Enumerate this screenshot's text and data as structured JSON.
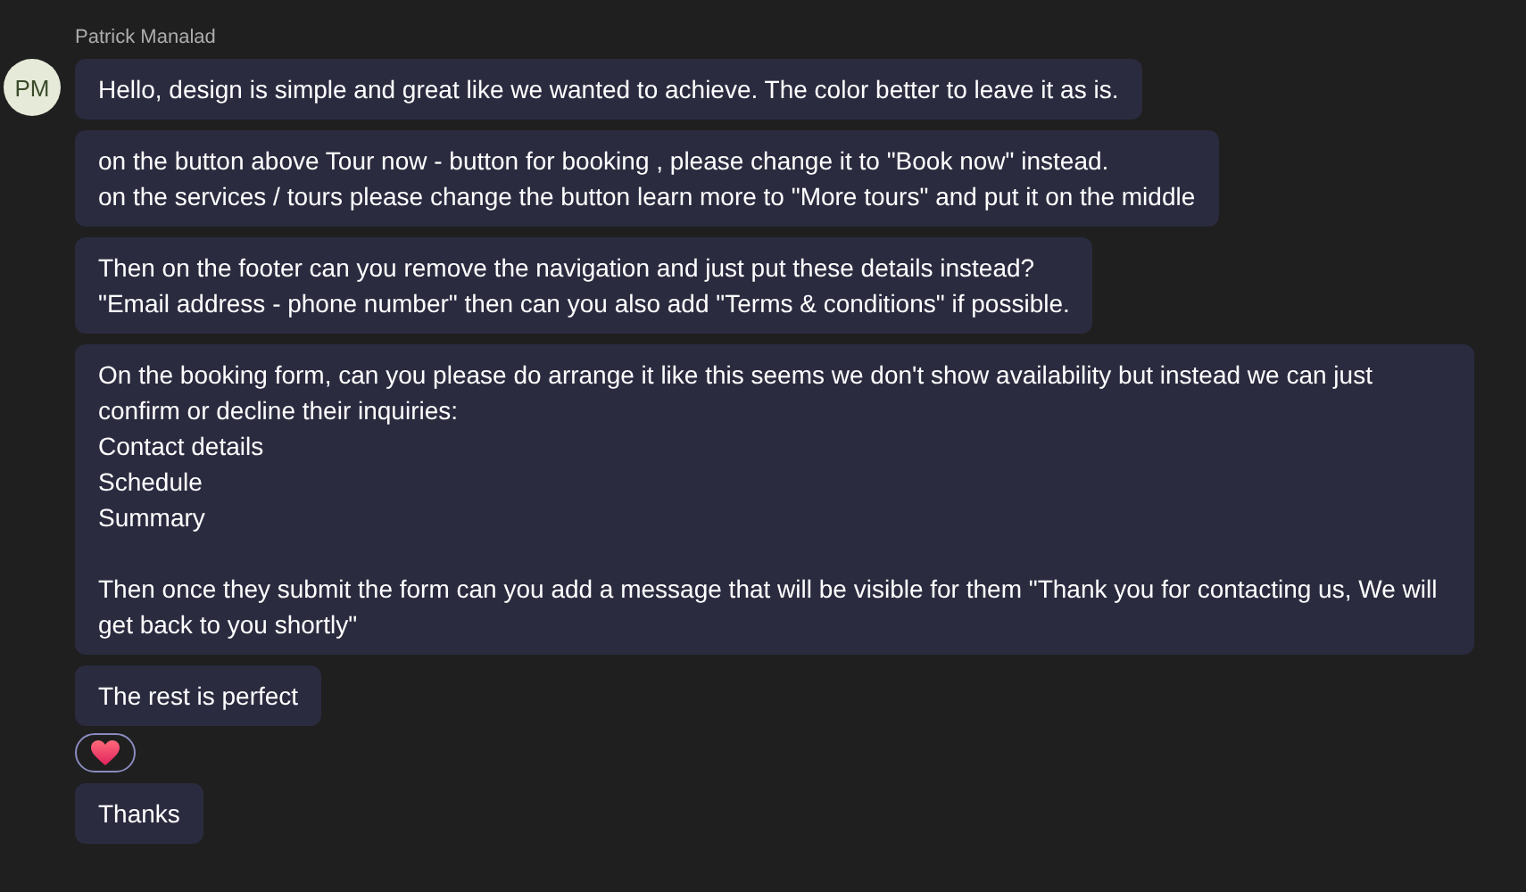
{
  "sender": {
    "name": "Patrick Manalad",
    "initials": "PM"
  },
  "messages": [
    {
      "text": "Hello, design is simple and great like we wanted to achieve. The color better to leave it as is."
    },
    {
      "text": "on the button above Tour now - button for booking , please change it to \"Book now\" instead.\non the services / tours please change the button learn more to \"More tours\" and put it on the middle\n "
    },
    {
      "text": "Then on the footer can you remove the navigation and just put these details instead?\n\"Email address - phone number\" then can you also add \"Terms & conditions\" if possible."
    },
    {
      "text": "On the booking form, can you please do arrange it like this seems we don't show availability but instead we can just confirm or decline their inquiries:\nContact details\nSchedule\nSummary\n\nThen once they submit the form can you add a message that will be visible for them \"Thank you for contacting us, We will get back to you shortly\""
    },
    {
      "text": "The rest is perfect",
      "reactions": [
        {
          "kind": "heart"
        }
      ]
    },
    {
      "text": "Thanks"
    }
  ]
}
